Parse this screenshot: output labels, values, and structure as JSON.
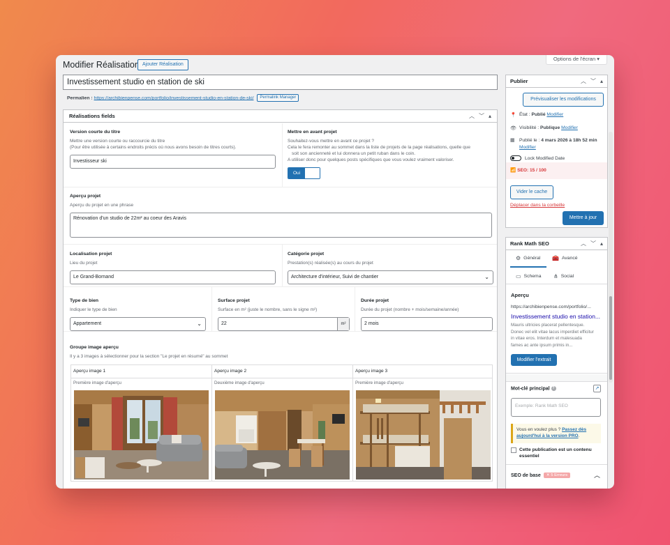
{
  "header": {
    "page_title": "Modifier Réalisation",
    "add_button": "Ajouter Réalisation",
    "screen_options": "Options de l'écran ▾"
  },
  "post": {
    "title": "Investissement studio en station de ski",
    "permalink_label": "Permalien :",
    "permalink_url": "https://archibienpense.com/portfolio/investissement-studio-en-station-de-ski/",
    "permalink_manager": "Permalink Manager"
  },
  "fields_box": {
    "title": "Réalisations fields",
    "short_title": {
      "label": "Version courte du titre",
      "desc1": "Mettre une version courte ou raccourcie du titre",
      "desc2": "(Pour être utilisée à certains endroits précis où nous avons besoin de titres courts).",
      "value": "Investisseur ski"
    },
    "featured": {
      "label": "Mettre en avant projet",
      "desc1": "Souhaitez-vous mettre en avant ce projet ?",
      "desc2": "Cela le fera remonter au sommet dans la liste de projets de la page réalisations, quelle que",
      "desc3": "soit son ancienneté et lui donnera un petit ruban dans le coin.",
      "desc4": "A utiliser donc pour quelques posts spécifiques que vous voulez vraiment valoriser.",
      "toggle_label": "Oui",
      "state": true
    },
    "preview": {
      "label": "Aperçu projet",
      "desc": "Aperçu du projet en une phrase",
      "value": "Rénovation d'un studio de 22m² au coeur des Aravis"
    },
    "location": {
      "label": "Localisation projet",
      "desc": "Lieu du projet",
      "value": "Le Grand-Bornand"
    },
    "category": {
      "label": "Catégorie projet",
      "desc": "Prestation(s) réalisée(s) au cours du projet",
      "value": "Architecture d'intérieur, Suivi de chantier"
    },
    "property_type": {
      "label": "Type de bien",
      "desc": "Indiquer le type de bien",
      "value": "Appartement"
    },
    "surface": {
      "label": "Surface projet",
      "desc": "Surface en m² (juste le nombre, sans le signe m²)",
      "value": "22",
      "unit": "m²"
    },
    "duration": {
      "label": "Durée projet",
      "desc": "Durée du projet (nombre + mois/semaine/année)",
      "value": "2 mois"
    },
    "image_group": {
      "label": "Groupe image aperçu",
      "desc": "Il y a 3 images à sélectionner pour la section \"Le projet en résumé\" au sommet",
      "images": [
        {
          "title": "Aperçu image 1",
          "desc": "Première image d'aperçu"
        },
        {
          "title": "Aperçu image 2",
          "desc": "Deuxième image d'aperçu"
        },
        {
          "title": "Aperçu image 3",
          "desc": "Première image d'aperçu"
        }
      ]
    }
  },
  "publish": {
    "title": "Publier",
    "preview_button": "Prévisualiser les modifications",
    "status_label": "État :",
    "status_value": "Publié",
    "visibility_label": "Visibilité :",
    "visibility_value": "Publique",
    "published_label": "Publié le :",
    "published_value": "4 mars 2026 à 18h 52 min",
    "modify": "Modifier",
    "lock_label": "Lock Modified Date",
    "seo_score": "SEO: 15 / 100",
    "clear_cache": "Vider le cache",
    "trash": "Déplacer dans la corbeille",
    "update": "Mettre à jour"
  },
  "rankmath": {
    "title": "Rank Math SEO",
    "tabs": [
      "Général",
      "Avancé",
      "Schema",
      "Social"
    ],
    "preview_heading": "Aperçu",
    "preview_url": "https://archibienpense.com/portfolio/...",
    "preview_title": "Investissement studio en station...",
    "preview_desc1": "Mauris ultricies placerat pellentesque.",
    "preview_desc2": "Donec vel elit vitae lacus imperdiet efficitur",
    "preview_desc3": "in vitae eros. Interdum et malesuada",
    "preview_desc4": "fames ac ante ipsum primis in...",
    "edit_snippet": "Modifier l'extrait",
    "keyword_label": "Mot-clé principal",
    "keyword_placeholder": "Exemple: Rank Math SEO",
    "upsell1": "Vous en voulez plus ?",
    "upsell_link1": "Passez dès",
    "upsell_link2": "aujourd'hui à la version PRO",
    "upsell_end": ".",
    "pillar_line1": "Cette publication est un contenu",
    "pillar_line2": "essentiel",
    "basic_seo": "SEO de base",
    "errors_badge": "✕ 5 Erreurs"
  },
  "colors": {
    "accent": "#2271b1",
    "danger": "#d63638",
    "background_gradient_start": "#f08a4c",
    "background_gradient_end": "#f0536f"
  }
}
